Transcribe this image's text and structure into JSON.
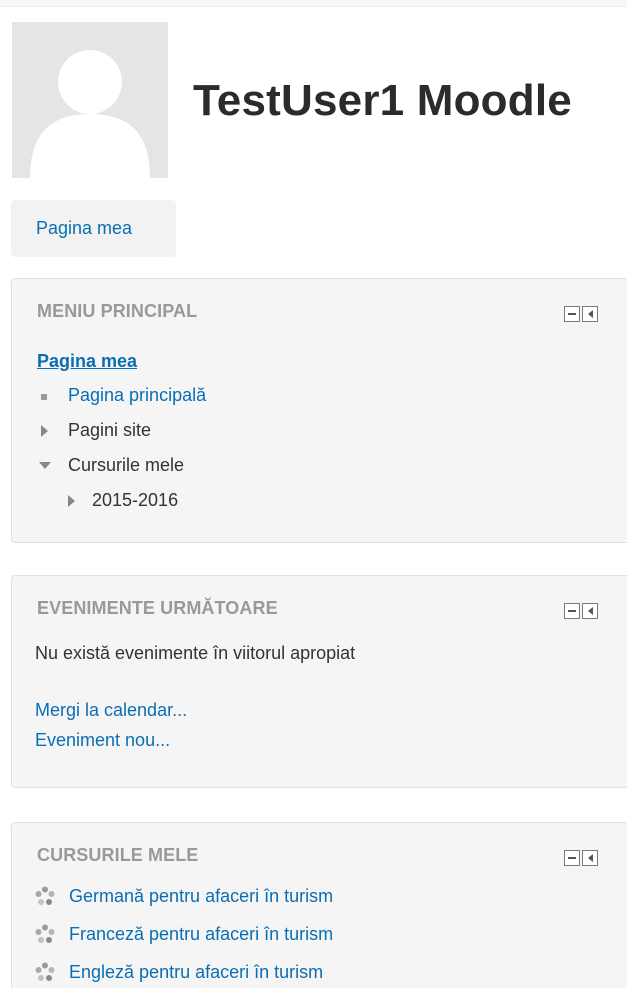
{
  "user": {
    "full_name": "TestUser1 Moodle"
  },
  "nav_tab": {
    "label": "Pagina mea"
  },
  "main_menu": {
    "title": "MENIU PRINCIPAL",
    "root_link": "Pagina mea",
    "items": [
      {
        "label": "Pagina principală",
        "kind": "link",
        "icon": "square-bullet-icon"
      },
      {
        "label": "Pagini site",
        "kind": "collapsed",
        "icon": "triangle-right-icon"
      },
      {
        "label": "Cursurile mele",
        "kind": "expanded",
        "icon": "triangle-down-icon"
      },
      {
        "label": "2015-2016",
        "kind": "collapsed",
        "icon": "triangle-right-icon"
      }
    ]
  },
  "upcoming_events": {
    "title": "EVENIMENTE URMĂTOARE",
    "empty_text": "Nu există evenimente în viitorul apropiat",
    "calendar_link": "Mergi la calendar...",
    "new_event_link": "Eveniment nou..."
  },
  "my_courses": {
    "title": "CURSURILE MELE",
    "courses": [
      "Germană pentru afaceri în turism",
      "Franceză pentru afaceri în turism",
      "Engleză pentru afaceri în turism"
    ]
  },
  "colors": {
    "link": "#0a6eb4",
    "block_title": "#999999",
    "block_bg": "#f5f5f5",
    "text": "#333333"
  }
}
